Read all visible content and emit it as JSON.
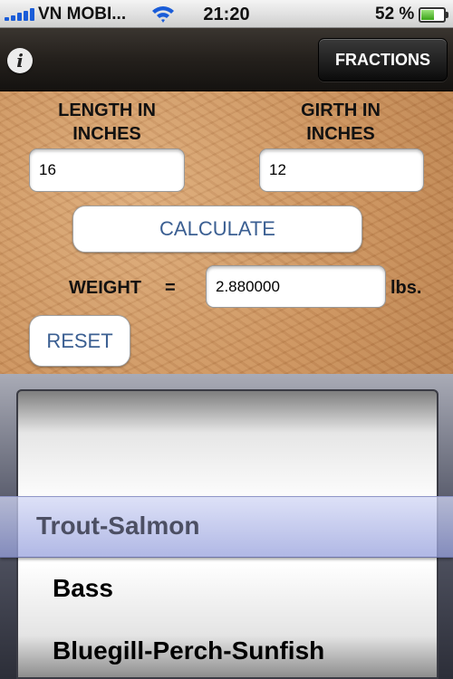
{
  "status_bar": {
    "carrier": "VN MOBI...",
    "time": "21:20",
    "battery_percent": "52 %",
    "battery_level": 0.52
  },
  "nav": {
    "info_label": "i",
    "fractions_label": "FRACTIONS"
  },
  "form": {
    "length_label": "LENGTH IN\nINCHES",
    "length_value": "16",
    "girth_label": "GIRTH IN\nINCHES",
    "girth_value": "12",
    "calculate_label": "CALCULATE",
    "weight_label": "WEIGHT",
    "equals": "=",
    "weight_value": "2.880000",
    "unit": "lbs.",
    "reset_label": "RESET"
  },
  "picker": {
    "selected": "Trout-Salmon",
    "items": [
      "Bass",
      "Bluegill-Perch-Sunfish"
    ]
  }
}
